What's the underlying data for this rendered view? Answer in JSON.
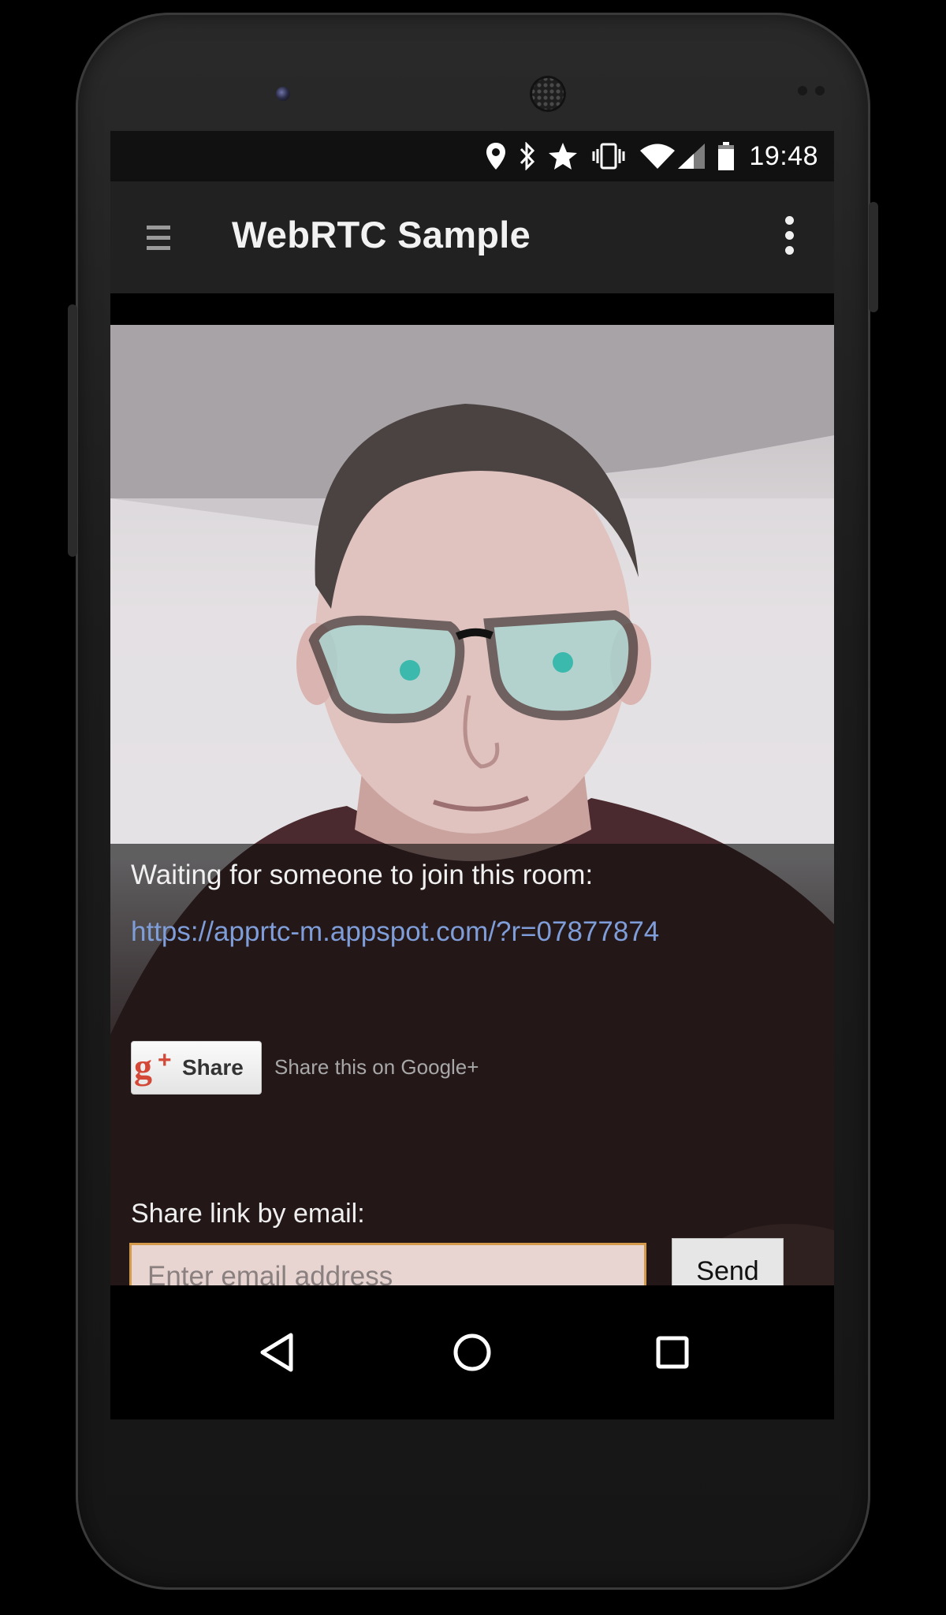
{
  "status_bar": {
    "time": "19:48",
    "icons": [
      "location-icon",
      "bluetooth-icon",
      "star-icon",
      "vibrate-icon",
      "wifi-icon",
      "cell-signal-icon",
      "battery-icon"
    ]
  },
  "action_bar": {
    "title": "WebRTC Sample",
    "menu_icon": "hamburger-menu-icon",
    "overflow_icon": "overflow-menu-icon"
  },
  "room": {
    "waiting_text": "Waiting for someone to join this room:",
    "link": "https://apprtc-m.appspot.com/?r=07877874"
  },
  "share": {
    "gplus_label": "Share",
    "gplus_caption": "Share this on Google+",
    "gplus_icon": "google-plus-icon"
  },
  "email": {
    "label": "Share link by email:",
    "placeholder": "Enter email address",
    "value": "",
    "send_label": "Send"
  },
  "navigation": {
    "back_icon": "back-icon",
    "home_icon": "home-icon",
    "recents_icon": "recents-icon"
  },
  "colors": {
    "link": "#7f9ed9",
    "input_border": "#d29a4a",
    "action_bar": "#212121"
  }
}
